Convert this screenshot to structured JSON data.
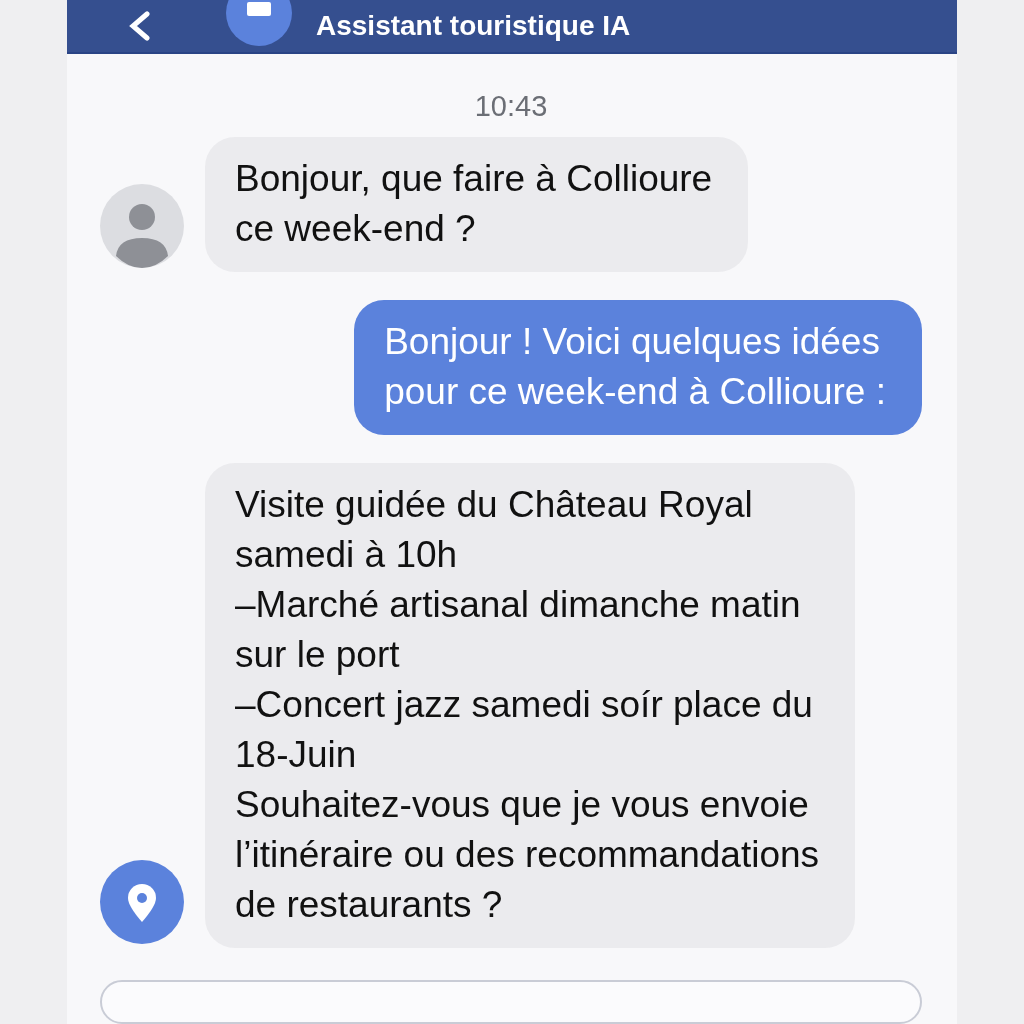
{
  "header": {
    "title": "Assistant touristique IA"
  },
  "timestamp": "10:43",
  "messages": [
    {
      "kind": "person",
      "text": "Bonjour, que faire à Collioure\nce week-end ?"
    },
    {
      "kind": "reply",
      "text": "Bonjour ! Voici quelques idées\npour ce week-end à Collioure :"
    },
    {
      "kind": "pin",
      "text": "Visite guidée du Château Royal\nsamedi à 10h\n–Marché artisanal dimanche matin\nsur le port\n–Concert jazz samedi soír place du\n18-Juin\nSouhaitez-vous que je vous envoie\nl’itinéraire ou des recommandations\nde restaurants ?"
    }
  ]
}
